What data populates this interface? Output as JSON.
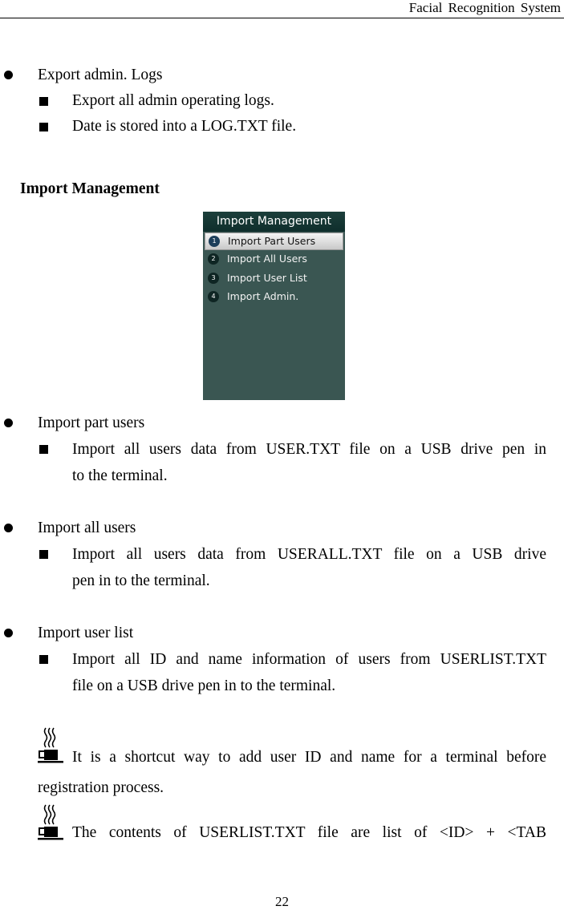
{
  "header": {
    "title": "Facial  Recognition  System"
  },
  "export_admin_logs": {
    "title": "Export admin. Logs",
    "items": [
      "Export all admin operating logs.",
      "Date is stored into a LOG.TXT file."
    ]
  },
  "import_management": {
    "heading": "Import Management",
    "screen": {
      "title": "Import Management",
      "colors": {
        "background": "#3a5652",
        "title_bar": "#153633",
        "selected": "#dcdcdc"
      },
      "menu": [
        {
          "number": "1",
          "label": "Import Part Users",
          "selected": true
        },
        {
          "number": "2",
          "label": "Import All Users",
          "selected": false
        },
        {
          "number": "3",
          "label": "Import User List",
          "selected": false
        },
        {
          "number": "4",
          "label": "Import Admin.",
          "selected": false
        }
      ]
    }
  },
  "sections": [
    {
      "title": "Import part users",
      "detail": "Import all users data from USER.TXT file on a USB drive pen in",
      "detail_cont": "to the terminal."
    },
    {
      "title": "Import all users",
      "detail": "Import all users data from USERALL.TXT file on a USB drive",
      "detail_cont": "pen in to the terminal."
    },
    {
      "title": "Import user list",
      "detail": "Import all ID and name information of users from USERLIST.TXT",
      "detail_cont": "file on a USB drive pen in to the terminal."
    }
  ],
  "notes": [
    {
      "icon": "coffee-cup-icon",
      "text": "It is a shortcut way to add user ID and name for a terminal before",
      "text_cont": "registration process."
    },
    {
      "icon": "coffee-cup-icon",
      "text": "The contents of USERLIST.TXT file are list of <ID> + <TAB"
    }
  ],
  "footer": {
    "page_number": "22"
  }
}
